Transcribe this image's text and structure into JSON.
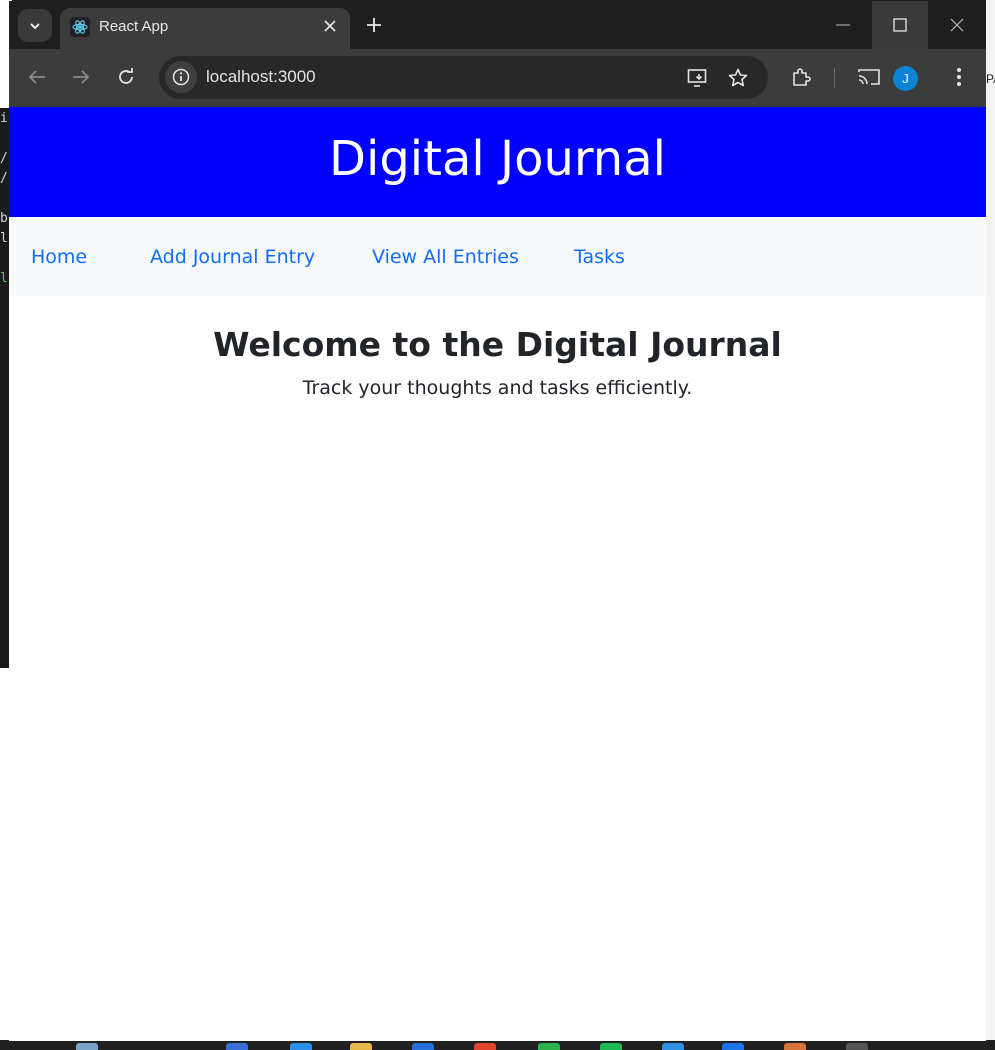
{
  "browser": {
    "tab_title": "React App",
    "url": "localhost:3000",
    "profile_initial": "J",
    "icons": [
      "tab-search-icon",
      "react-favicon-icon",
      "close-icon",
      "plus-icon",
      "minimize-icon",
      "maximize-icon",
      "window-close-icon",
      "back-icon",
      "forward-icon",
      "reload-icon",
      "site-info-icon",
      "install-app-icon",
      "bookmark-star-icon",
      "extensions-icon",
      "cast-icon",
      "more-menu-icon"
    ]
  },
  "header": {
    "title": "Digital Journal"
  },
  "nav": {
    "items": [
      {
        "label": "Home"
      },
      {
        "label": "Add Journal Entry"
      },
      {
        "label": "View All Entries"
      },
      {
        "label": "Tasks"
      }
    ]
  },
  "main": {
    "heading": "Welcome to the Digital Journal",
    "subtitle": "Track your thoughts and tasks efficiently."
  },
  "colors": {
    "header_bg": "#0000ff",
    "nav_bg": "#f8f9fa",
    "link": "#0d6efd",
    "text": "#212529"
  }
}
